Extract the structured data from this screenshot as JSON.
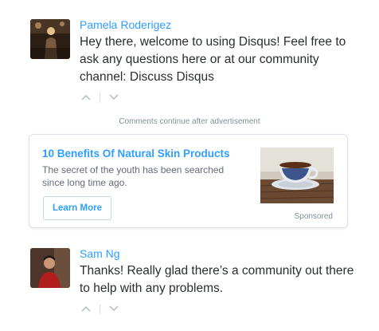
{
  "comments": [
    {
      "author": "Pamela Roderigez",
      "text": "Hey there, welcome to using Disqus! Feel free to ask any questions here or at our community channel: Discuss Disqus",
      "upvote_icon": "chevron-up-icon",
      "downvote_icon": "chevron-down-icon"
    },
    {
      "author": "Sam Ng",
      "text": "Thanks! Really glad there’s a community out there to help with any problems.",
      "upvote_icon": "chevron-up-icon",
      "downvote_icon": "chevron-down-icon"
    }
  ],
  "ad_notice": "Comments continue after advertisement",
  "ad": {
    "title": "10 Benefits Of Natural Skin Products",
    "description": "The secret of the youth has been searched since long time ago.",
    "button_label": "Learn More",
    "sponsored_label": "Sponsored",
    "image_icon": "teacup-photo"
  },
  "colors": {
    "link": "#2e9fff",
    "text": "#2a2e2e",
    "muted": "#7f919e",
    "border": "#dde3e8"
  }
}
